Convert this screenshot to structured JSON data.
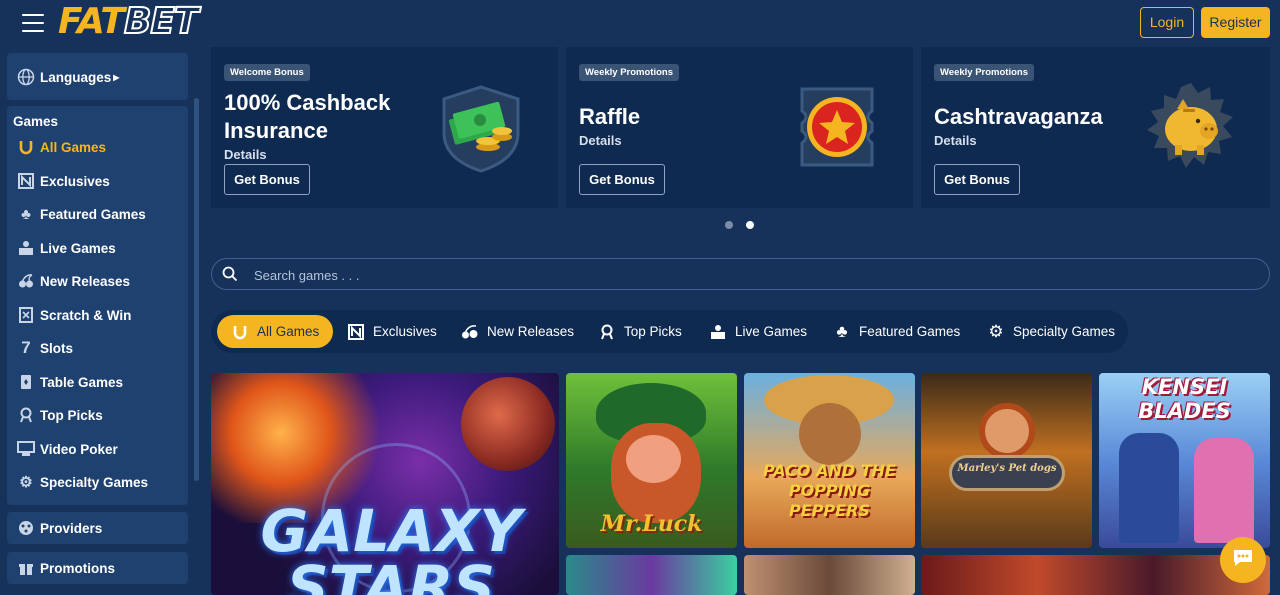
{
  "header": {
    "logo_fat": "FAT",
    "logo_bet": "BET",
    "login_label": "Login",
    "register_label": "Register"
  },
  "sidebar": {
    "languages_label": "Languages",
    "games_heading": "Games",
    "items": [
      {
        "label": "All Games",
        "icon": "horseshoe-icon",
        "active": true
      },
      {
        "label": "Exclusives",
        "icon": "exclusives-icon"
      },
      {
        "label": "Featured Games",
        "icon": "clover-icon"
      },
      {
        "label": "Live Games",
        "icon": "live-dealer-icon"
      },
      {
        "label": "New Releases",
        "icon": "cherries-icon"
      },
      {
        "label": "Scratch & Win",
        "icon": "scratch-card-icon"
      },
      {
        "label": "Slots",
        "icon": "seven-icon"
      },
      {
        "label": "Table Games",
        "icon": "cards-icon"
      },
      {
        "label": "Top Picks",
        "icon": "medal-icon"
      },
      {
        "label": "Video Poker",
        "icon": "video-poker-icon"
      },
      {
        "label": "Specialty Games",
        "icon": "gear-icon"
      }
    ],
    "providers_label": "Providers",
    "promotions_label": "Promotions"
  },
  "promos": [
    {
      "tag": "Welcome Bonus",
      "title_line1": "100% Cashback",
      "title_line2": "Insurance",
      "details": "Details",
      "button": "Get Bonus",
      "art": "cash-shield-icon"
    },
    {
      "tag": "Weekly Promotions",
      "title_line1": "Raffle",
      "details": "Details",
      "button": "Get Bonus",
      "art": "star-ticket-icon"
    },
    {
      "tag": "Weekly Promotions",
      "title_line1": "Cashtravaganza",
      "details": "Details",
      "button": "Get Bonus",
      "art": "piggy-bank-icon"
    }
  ],
  "carousel": {
    "pages": 2,
    "active_page": 2
  },
  "search": {
    "placeholder": "Search games . . ."
  },
  "tabs": [
    {
      "label": "All Games",
      "icon": "horseshoe-icon",
      "active": true
    },
    {
      "label": "Exclusives",
      "icon": "exclusives-icon"
    },
    {
      "label": "New Releases",
      "icon": "cherries-icon"
    },
    {
      "label": "Top Picks",
      "icon": "medal-icon"
    },
    {
      "label": "Live Games",
      "icon": "live-dealer-icon"
    },
    {
      "label": "Featured Games",
      "icon": "clover-icon"
    },
    {
      "label": "Specialty Games",
      "icon": "gear-icon"
    }
  ],
  "games": [
    {
      "name": "GALAXY STARS"
    },
    {
      "name": "Mr.Luck"
    },
    {
      "name": "PACO AND THE POPPING PEPPERS"
    },
    {
      "name": "Marley's Pet dogs"
    },
    {
      "name": "KENSEI BLADES"
    }
  ],
  "colors": {
    "accent": "#f5b521",
    "background": "#16325a",
    "panel": "#1f4170",
    "card": "#0f2a50"
  }
}
